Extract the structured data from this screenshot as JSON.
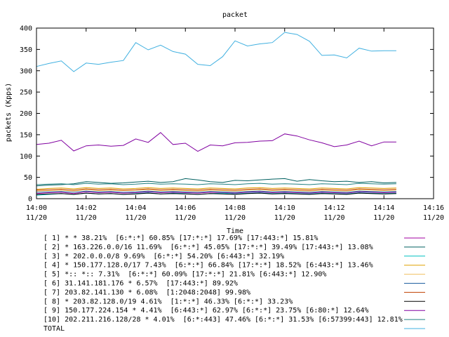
{
  "chart_data": {
    "type": "line",
    "title": "packet",
    "xlabel": "Time",
    "ylabel": "packets (Kpps)",
    "xlim": [
      0,
      16
    ],
    "ylim": [
      0,
      400
    ],
    "x_ticks": [
      {
        "value": 0,
        "time": "14:00",
        "date": "11/20"
      },
      {
        "value": 2,
        "time": "14:02",
        "date": "11/20"
      },
      {
        "value": 4,
        "time": "14:04",
        "date": "11/20"
      },
      {
        "value": 6,
        "time": "14:06",
        "date": "11/20"
      },
      {
        "value": 8,
        "time": "14:08",
        "date": "11/20"
      },
      {
        "value": 10,
        "time": "14:10",
        "date": "11/20"
      },
      {
        "value": 12,
        "time": "14:12",
        "date": "11/20"
      },
      {
        "value": 14,
        "time": "14:14",
        "date": "11/20"
      },
      {
        "value": 16,
        "time": "14:16",
        "date": "11/20"
      }
    ],
    "y_ticks": [
      0,
      50,
      100,
      150,
      200,
      250,
      300,
      350,
      400
    ],
    "x": [
      0,
      0.5,
      1,
      1.5,
      2,
      2.5,
      3,
      3.5,
      4,
      4.5,
      5,
      5.5,
      6,
      6.5,
      7,
      7.5,
      8,
      8.5,
      9,
      9.5,
      10,
      10.5,
      11,
      11.5,
      12,
      12.5,
      13,
      13.5,
      14,
      14.5
    ],
    "series": [
      {
        "name": "[ 1] * * 38.21%  [6:*:*] 60.85% [17:*:*] 17.69% [17:443:*] 15.81%",
        "color": "#a000a0",
        "values": [
          12,
          14,
          15,
          12,
          16,
          14,
          15,
          13,
          14,
          16,
          14,
          15,
          14,
          13,
          15,
          14,
          13,
          15,
          16,
          14,
          15,
          14,
          13,
          15,
          14,
          13,
          16,
          15,
          14,
          15
        ]
      },
      {
        "name": "[ 2] * 163.226.0.0/16 11.69%  [6:*:*] 45.05% [17:*:*] 39.49% [17:443:*] 13.08%",
        "color": "#006060",
        "values": [
          30,
          32,
          33,
          35,
          40,
          38,
          36,
          37,
          39,
          41,
          38,
          40,
          47,
          44,
          40,
          38,
          43,
          42,
          44,
          46,
          47,
          41,
          45,
          42,
          40,
          41,
          38,
          40,
          37,
          38
        ]
      },
      {
        "name": "[ 3] * 202.0.0.0/8 9.69%  [6:*:*] 54.20% [6:443:*] 32.19%",
        "color": "#00c0c0",
        "values": [
          8,
          10,
          12,
          10,
          13,
          11,
          12,
          10,
          12,
          14,
          11,
          13,
          12,
          10,
          12,
          13,
          11,
          13,
          14,
          12,
          13,
          12,
          11,
          13,
          12,
          11,
          14,
          13,
          12,
          13
        ]
      },
      {
        "name": "[ 4] * 150.177.128.0/17 7.43%  [6:*:*] 66.84% [17:*:*] 18.52% [6:443:*] 13.46%",
        "color": "#e0a000",
        "values": [
          22,
          24,
          25,
          23,
          26,
          24,
          25,
          23,
          24,
          26,
          24,
          25,
          24,
          23,
          25,
          24,
          23,
          25,
          26,
          24,
          25,
          24,
          23,
          25,
          24,
          23,
          26,
          25,
          24,
          25
        ]
      },
      {
        "name": "[ 5] *:: *:: 7.31%  [6:*:*] 60.09% [17:*:*] 21.81% [6:443:*] 12.90%",
        "color": "#f0c060",
        "values": [
          18,
          19,
          20,
          18,
          21,
          19,
          20,
          19,
          20,
          21,
          19,
          20,
          19,
          18,
          20,
          19,
          18,
          20,
          21,
          19,
          20,
          19,
          18,
          20,
          19,
          18,
          21,
          20,
          19,
          20
        ]
      },
      {
        "name": "[ 6] 31.141.181.176 * 6.57%  [17:443:*] 89.92%",
        "color": "#2060a0",
        "values": [
          15,
          16,
          17,
          15,
          18,
          16,
          17,
          15,
          16,
          18,
          16,
          17,
          16,
          15,
          17,
          16,
          15,
          17,
          18,
          16,
          17,
          16,
          15,
          17,
          16,
          15,
          18,
          17,
          16,
          17
        ]
      },
      {
        "name": "[ 7] 203.82.141.130 * 6.08%  [1:2048:2048] 99.98%",
        "color": "#c04000",
        "values": [
          20,
          21,
          22,
          20,
          23,
          21,
          22,
          20,
          21,
          23,
          21,
          22,
          21,
          20,
          22,
          21,
          20,
          22,
          23,
          21,
          22,
          21,
          20,
          22,
          21,
          20,
          23,
          22,
          21,
          22
        ]
      },
      {
        "name": "[ 8] * 203.82.128.0/19 4.61%  [1:*:*] 46.33% [6:*:*] 33.23%",
        "color": "#000000",
        "values": [
          10,
          11,
          12,
          10,
          13,
          11,
          12,
          10,
          11,
          13,
          11,
          12,
          11,
          10,
          12,
          11,
          10,
          12,
          13,
          11,
          12,
          11,
          10,
          12,
          11,
          10,
          13,
          12,
          11,
          12
        ]
      },
      {
        "name": "[ 9] 150.177.224.154 * 4.41%  [6:443:*] 62.97% [6:*:*] 23.75% [6:80:*] 12.64%",
        "color": "#8000a0",
        "values": [
          127,
          130,
          137,
          112,
          124,
          126,
          123,
          125,
          140,
          132,
          155,
          127,
          130,
          111,
          126,
          124,
          131,
          132,
          135,
          136,
          152,
          147,
          138,
          131,
          122,
          126,
          135,
          124,
          133,
          133
        ]
      },
      {
        "name": "[10] 202.211.216.128/28 * 4.01%  [6:*:443] 47.46% [6:*:*] 31.53% [6:57399:443] 12.81%",
        "color": "#208080",
        "values": [
          33,
          34,
          35,
          33,
          36,
          34,
          35,
          33,
          34,
          36,
          34,
          35,
          34,
          33,
          35,
          34,
          33,
          35,
          36,
          34,
          35,
          34,
          33,
          35,
          34,
          33,
          36,
          35,
          34,
          35
        ]
      },
      {
        "name": "TOTAL",
        "color": "#40b0e0",
        "values": [
          310,
          317,
          323,
          298,
          318,
          315,
          320,
          324,
          366,
          349,
          360,
          345,
          339,
          315,
          312,
          333,
          370,
          358,
          363,
          366,
          390,
          385,
          369,
          336,
          337,
          330,
          353,
          346,
          347,
          347
        ]
      }
    ]
  }
}
